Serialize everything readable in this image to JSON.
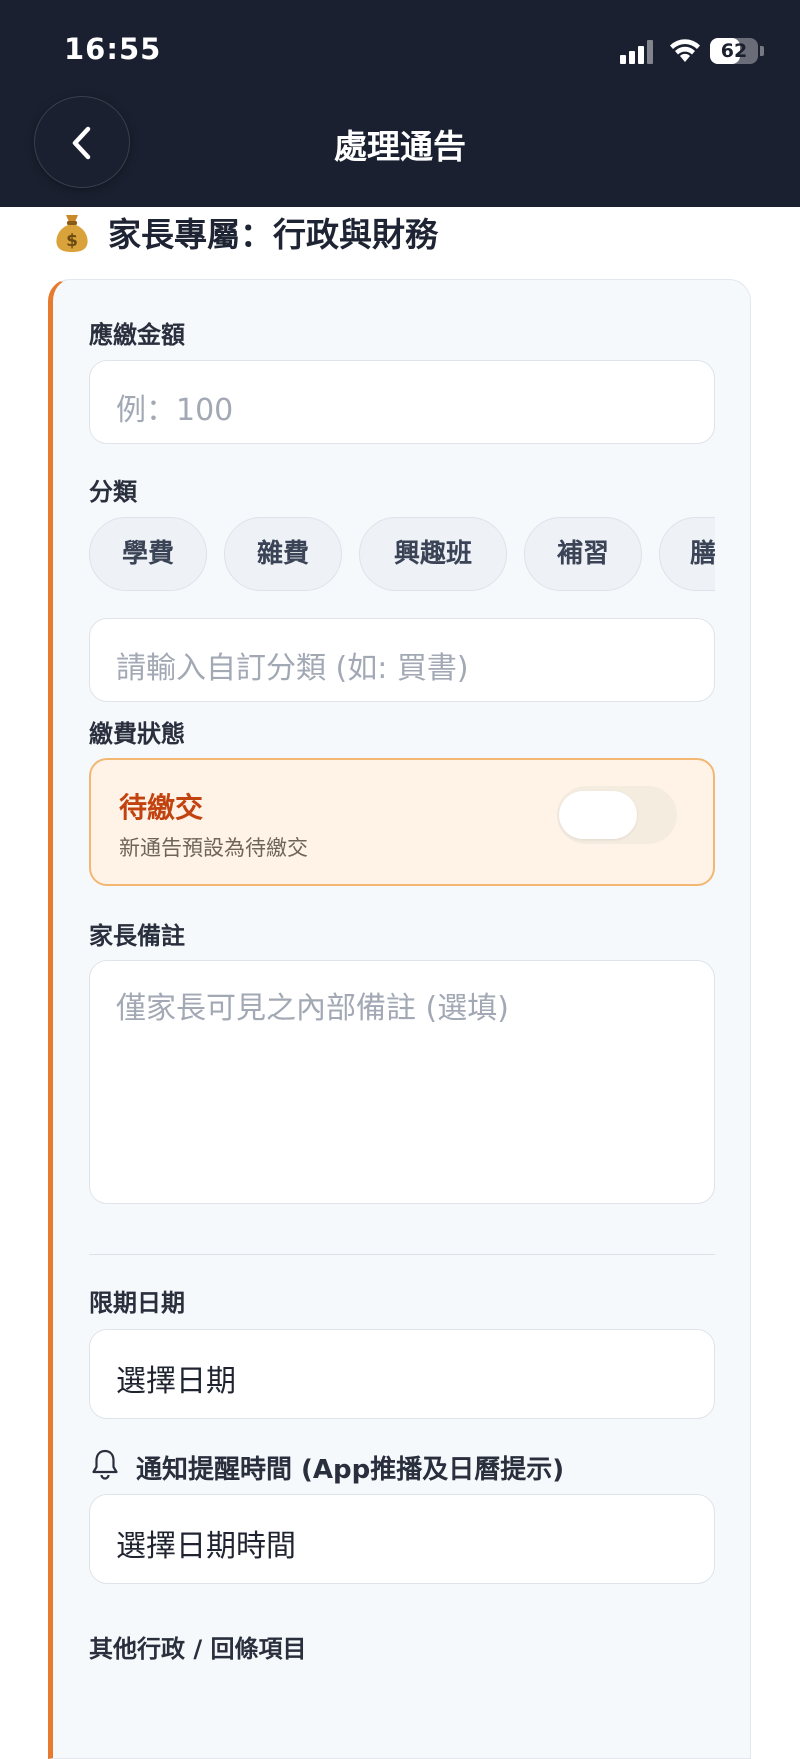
{
  "status_bar": {
    "time": "16:55",
    "battery": "62",
    "battery_level": 0.62
  },
  "nav": {
    "title": "處理通告"
  },
  "section": {
    "icon": "moneybag-icon",
    "title": "家長專屬：行政與財務"
  },
  "form": {
    "amount": {
      "label": "應繳金額",
      "placeholder": "例：100"
    },
    "category": {
      "label": "分類",
      "chips": [
        "學費",
        "雜費",
        "興趣班",
        "補習",
        "膳"
      ],
      "custom_placeholder": "請輸入自訂分類 (如: 買書)"
    },
    "payment_status": {
      "label": "繳費狀態",
      "state_title": "待繳交",
      "state_subtitle": "新通告預設為待繳交",
      "toggle_on": false
    },
    "parent_note": {
      "label": "家長備註",
      "placeholder": "僅家長可見之內部備註 (選填)"
    },
    "deadline": {
      "label": "限期日期",
      "value": "選擇日期"
    },
    "reminder": {
      "icon": "bell-icon",
      "label": "通知提醒時間 (App推播及日曆提示)",
      "value": "選擇日期時間"
    },
    "other": {
      "label": "其他行政 / 回條項目"
    }
  },
  "colors": {
    "accent": "#e67a2e",
    "status_text": "#c2430f",
    "header_bg": "#1b2030"
  }
}
